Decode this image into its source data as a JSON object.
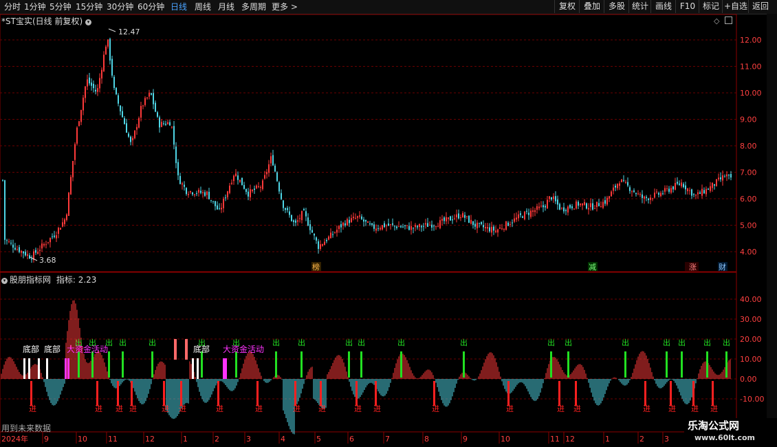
{
  "toolbar": {
    "periods": [
      "分时",
      "1分钟",
      "5分钟",
      "15分钟",
      "30分钟",
      "60分钟",
      "日线",
      "周线",
      "月线",
      "多周期",
      "更多"
    ],
    "active_period": "日线",
    "right_buttons": [
      "复权",
      "叠加",
      "多股",
      "统计",
      "画线",
      "F10",
      "标记",
      "+自选",
      "返回"
    ]
  },
  "main_chart": {
    "title": "*ST宝实(日线 前复权)",
    "price_axis": [
      "12.00",
      "11.00",
      "10.00",
      "9.00",
      "8.00",
      "7.00",
      "6.00",
      "5.00",
      "4.00"
    ],
    "high_label": "12.47",
    "low_label": "3.68",
    "event_markers": [
      "榜",
      "减",
      "涨",
      "财"
    ],
    "colors": {
      "up": "#ff3a3a",
      "down": "#4fd6e6",
      "grid": "#6b0000"
    }
  },
  "indicator": {
    "title": "股朋指标网",
    "value_label": "指标: 2.23",
    "axis": [
      "40.00",
      "30.00",
      "20.00",
      "10.00",
      "0.00",
      "-10.00"
    ],
    "labels": {
      "out": "出",
      "in": "进",
      "bottom": "底部",
      "big_money": "大资金活动"
    }
  },
  "date_axis": [
    "2024年",
    "9",
    "10",
    "11",
    "12",
    "1",
    "2",
    "3",
    "4",
    "5",
    "6",
    "7",
    "8",
    "9",
    "10",
    "11",
    "12",
    "1",
    "2",
    "3"
  ],
  "footer": {
    "future_data": "用到未来数据"
  },
  "watermark": {
    "name": "乐淘公式网",
    "url": "www.60lt.com"
  }
}
